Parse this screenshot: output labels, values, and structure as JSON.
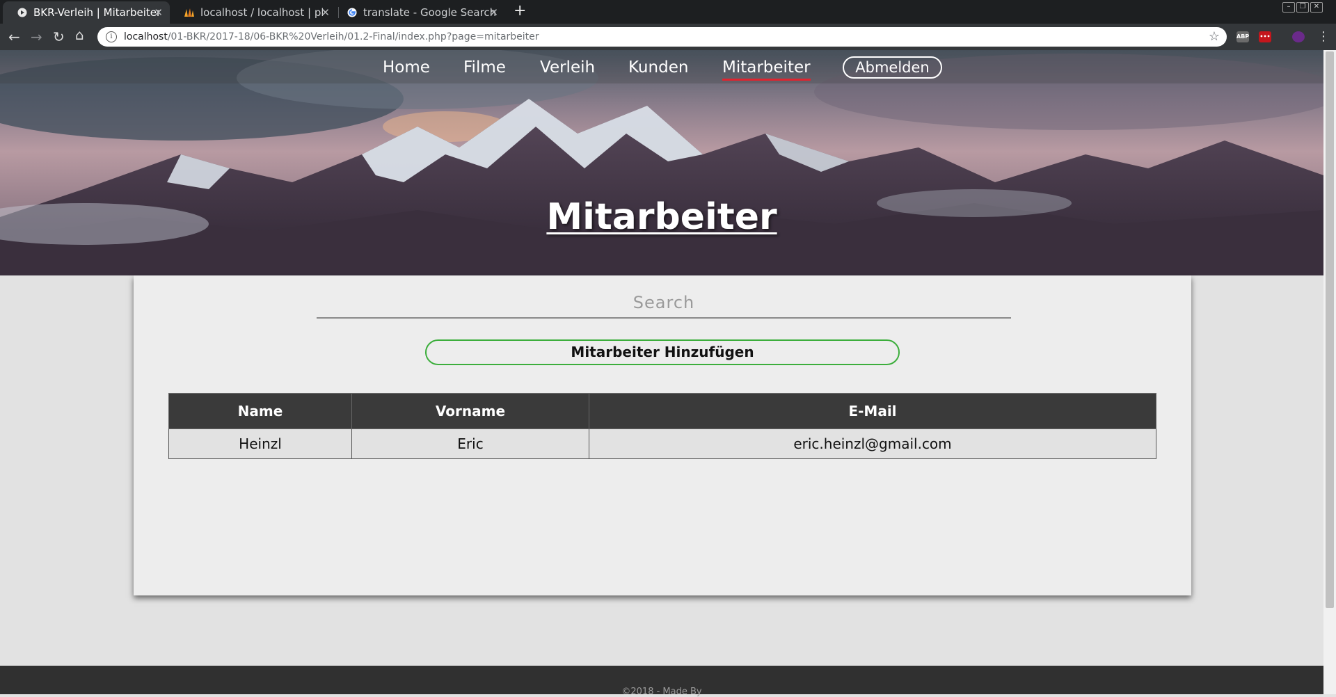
{
  "browser": {
    "tabs": [
      {
        "title": "BKR-Verleih | Mitarbeiter",
        "icon": "page-favicon",
        "active": true
      },
      {
        "title": "localhost / localhost | php",
        "icon": "phpmyadmin-favicon",
        "active": false
      },
      {
        "title": "translate - Google Search",
        "icon": "google-favicon",
        "active": false
      }
    ],
    "new_tab_symbol": "+",
    "url_host": "localhost",
    "url_path": "/01-BKR/2017-18/06-BKR%20Verleih/01.2-Final/index.php?page=mitarbeiter",
    "ext_labels": [
      "ABP",
      "•••"
    ]
  },
  "nav": {
    "links": [
      "Home",
      "Filme",
      "Verleih",
      "Kunden",
      "Mitarbeiter"
    ],
    "active": "Mitarbeiter",
    "logout_label": "Abmelden",
    "active_underline_color": "#e0242f"
  },
  "hero": {
    "title": "Mitarbeiter"
  },
  "main": {
    "search_placeholder": "Search",
    "add_button_label": "Mitarbeiter Hinzufügen",
    "add_button_border_color": "#3cae3c",
    "table": {
      "headers": [
        "Name",
        "Vorname",
        "E-Mail"
      ],
      "rows": [
        [
          "Heinzl",
          "Eric",
          "eric.heinzl@gmail.com"
        ]
      ]
    }
  },
  "footer": {
    "text": "©2018 - Made By"
  }
}
